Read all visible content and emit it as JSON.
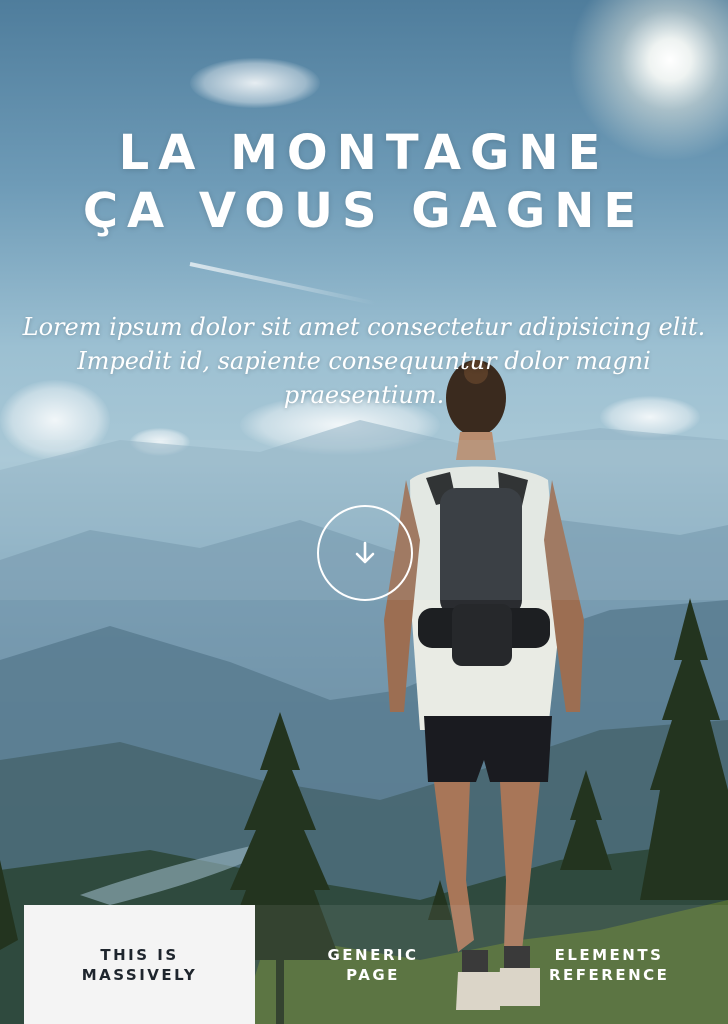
{
  "hero": {
    "headline_line1": "LA MONTAGNE",
    "headline_line2": "ÇA VOUS GAGNE",
    "intro": "Lorem ipsum dolor sit amet consectetur adipisicing elit. Impedit id, sapiente consequuntur dolor magni praesentium.",
    "scroll_icon": "arrow-down-icon"
  },
  "nav": {
    "items": [
      {
        "label": "THIS IS MASSIVELY",
        "active": true
      },
      {
        "label": "GENERIC PAGE",
        "active": false
      },
      {
        "label": "ELEMENTS REFERENCE",
        "active": false
      }
    ]
  },
  "colors": {
    "text_light": "#ffffff",
    "nav_active_bg": "#f4f4f4",
    "nav_active_text": "#1e252d",
    "sky": "#6e9bb7"
  }
}
